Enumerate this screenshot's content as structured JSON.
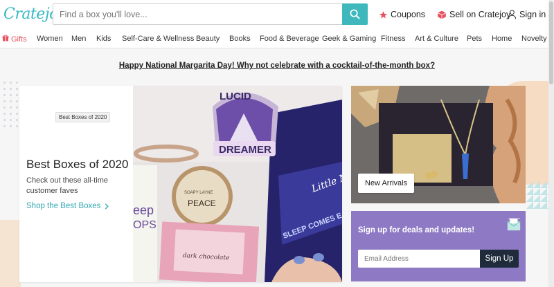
{
  "header": {
    "logo_text": "Cratejoy",
    "search": {
      "placeholder": "Find a box you'll love...",
      "value": ""
    },
    "coupons_label": "Coupons",
    "sell_label": "Sell on Cratejoy",
    "signin_label": "Sign in",
    "colors": {
      "brand": "#37b9c6",
      "search_button": "#3fb8bd",
      "coupon_star": "#e8525f",
      "sell_icon": "#e8525f"
    },
    "icons": {
      "search": "magnifier-icon",
      "coupons": "star-icon",
      "sell": "box-icon",
      "signin": "user-icon"
    }
  },
  "categories": [
    {
      "label": "Gifts",
      "icon": "gift-icon",
      "color": "#e8525f"
    },
    {
      "label": "Women"
    },
    {
      "label": "Men"
    },
    {
      "label": "Kids"
    },
    {
      "label": "Self-Care & Wellness"
    },
    {
      "label": "Beauty"
    },
    {
      "label": "Books"
    },
    {
      "label": "Food & Beverage"
    },
    {
      "label": "Geek & Gaming"
    },
    {
      "label": "Fitness"
    },
    {
      "label": "Art & Culture"
    },
    {
      "label": "Pets"
    },
    {
      "label": "Home"
    },
    {
      "label": "Novelty"
    }
  ],
  "promo": {
    "text": "Happy National Margarita Day! Why not celebrate with a cocktail-of-the-month box?"
  },
  "hero": {
    "badge": "Best Boxes of 2020",
    "title": "Best Boxes of 2020",
    "subtitle": "Check out these all-time customer faves",
    "link_label": "Shop the Best Boxes",
    "link_icon": "chevron-right-icon",
    "image": {
      "patch_text_top": "LUCID",
      "patch_text_bottom": "DREAMER",
      "tin_text_small": "SOAPY LAYNE",
      "tin_text": "PEACE",
      "bag_title_small": "Little M",
      "bag_line1": "SLEEP COMES EA",
      "box_left_text": "eep",
      "box_left_text2": "OPS",
      "chocolate_text": "dark chocolate"
    }
  },
  "arrivals": {
    "button_label": "New Arrivals"
  },
  "signup": {
    "title": "Sign up for deals and updates!",
    "email_placeholder": "Email Address",
    "button_label": "Sign Up",
    "icon": "envelope-icon",
    "background": "#8d79c4"
  }
}
